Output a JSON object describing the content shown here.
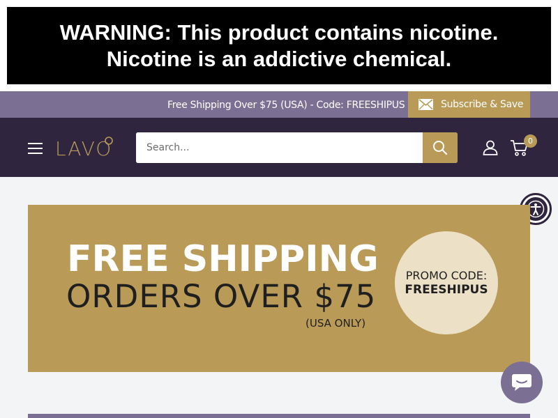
{
  "warning": {
    "line1": "WARNING: This product contains nicotine.",
    "line2": "Nicotine is an addictive chemical."
  },
  "promo_bar": {
    "text": "Free Shipping Over $75 (USA) - Code: FREESHIPUS",
    "subscribe_label": "Subscribe & Save",
    "subscribe_icon": "mail-icon"
  },
  "header": {
    "logo_text": "LAVO",
    "search_placeholder": "Search...",
    "cart_count": "0"
  },
  "banner": {
    "headline": "FREE SHIPPING",
    "subheadline": "ORDERS OVER $75",
    "note": "(USA ONLY)",
    "promo_label": "PROMO CODE:",
    "promo_code": "FREESHIPUS"
  },
  "colors": {
    "brand_dark": "#30253f",
    "brand_purple": "#7b6f93",
    "accent_gold": "#b99b57",
    "circle_cream": "#ece0c6"
  }
}
